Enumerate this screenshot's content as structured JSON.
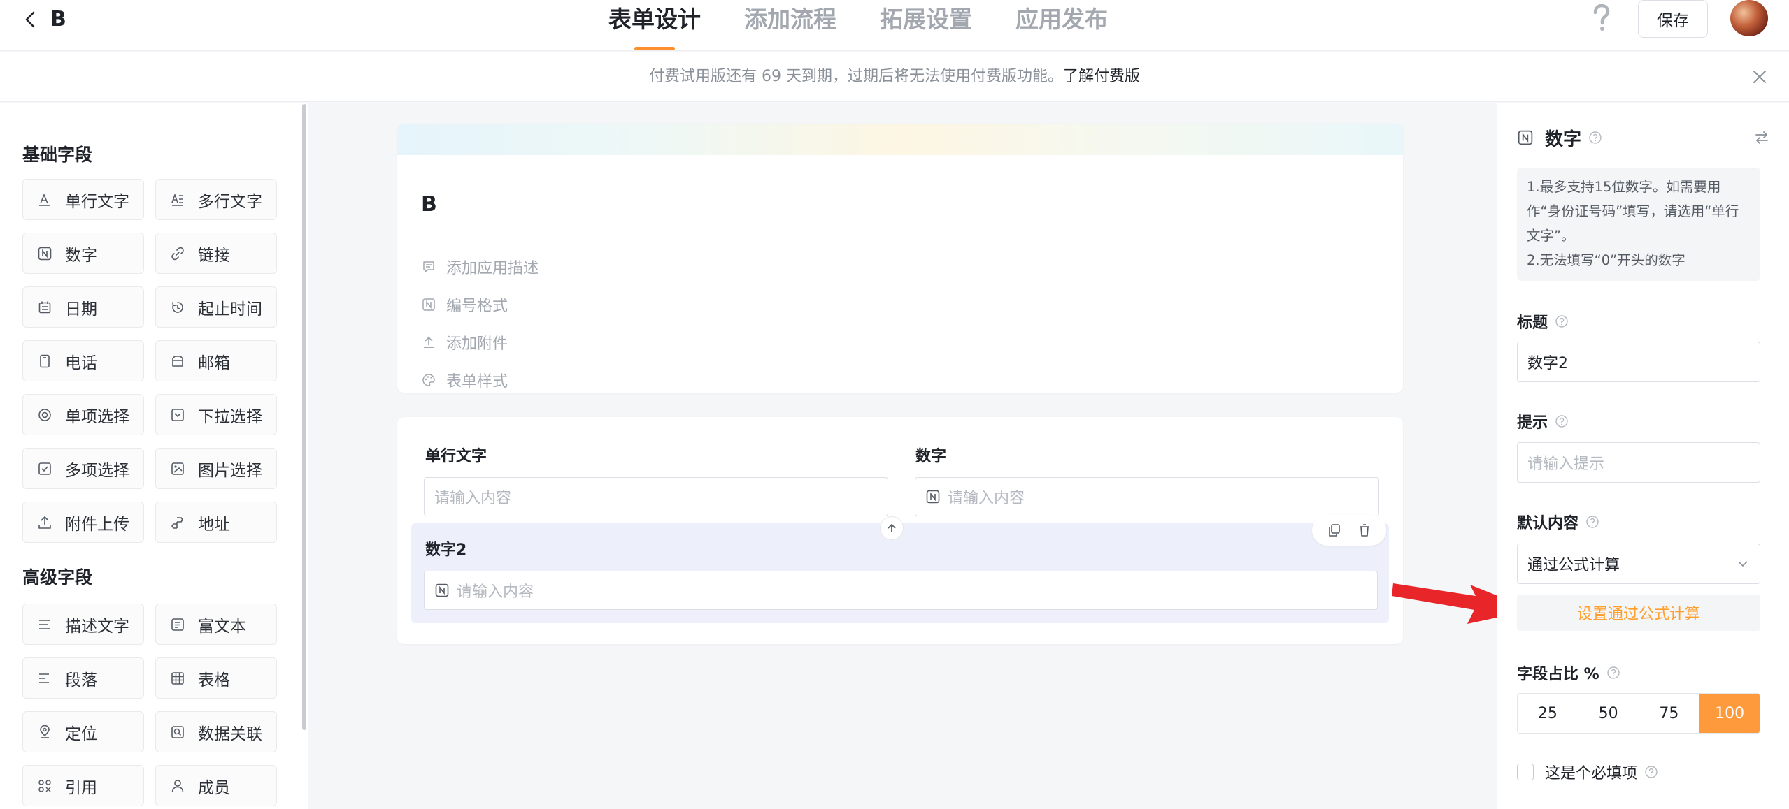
{
  "header": {
    "app_title": "B",
    "tabs": [
      {
        "label": "表单设计",
        "active": true
      },
      {
        "label": "添加流程",
        "active": false
      },
      {
        "label": "拓展设置",
        "active": false
      },
      {
        "label": "应用发布",
        "active": false
      }
    ],
    "save_label": "保存"
  },
  "banner": {
    "text": "付费试用版还有 69 天到期，过期后将无法使用付费版功能。",
    "link": "了解付费版"
  },
  "sidebar": {
    "basic_title": "基础字段",
    "basic_fields": [
      {
        "label": "单行文字",
        "icon": "text-icon"
      },
      {
        "label": "多行文字",
        "icon": "multiline-text-icon"
      },
      {
        "label": "数字",
        "icon": "number-icon"
      },
      {
        "label": "链接",
        "icon": "link-icon"
      },
      {
        "label": "日期",
        "icon": "calendar-icon"
      },
      {
        "label": "起止时间",
        "icon": "time-range-icon"
      },
      {
        "label": "电话",
        "icon": "phone-icon"
      },
      {
        "label": "邮箱",
        "icon": "mail-icon"
      },
      {
        "label": "单项选择",
        "icon": "radio-icon"
      },
      {
        "label": "下拉选择",
        "icon": "dropdown-icon"
      },
      {
        "label": "多项选择",
        "icon": "checkbox-icon"
      },
      {
        "label": "图片选择",
        "icon": "image-icon"
      },
      {
        "label": "附件上传",
        "icon": "upload-icon"
      },
      {
        "label": "地址",
        "icon": "address-icon"
      }
    ],
    "advanced_title": "高级字段",
    "advanced_fields": [
      {
        "label": "描述文字",
        "icon": "description-icon"
      },
      {
        "label": "富文本",
        "icon": "rich-text-icon"
      },
      {
        "label": "段落",
        "icon": "paragraph-icon"
      },
      {
        "label": "表格",
        "icon": "table-icon"
      },
      {
        "label": "定位",
        "icon": "location-icon"
      },
      {
        "label": "数据关联",
        "icon": "data-link-icon"
      },
      {
        "label": "引用",
        "icon": "reference-icon"
      },
      {
        "label": "成员",
        "icon": "member-icon"
      }
    ]
  },
  "form": {
    "title": "B",
    "meta": [
      {
        "label": "添加应用描述",
        "icon": "description-icon"
      },
      {
        "label": "编号格式",
        "icon": "number-format-icon"
      },
      {
        "label": "添加附件",
        "icon": "attachment-icon"
      },
      {
        "label": "表单样式",
        "icon": "palette-icon"
      }
    ],
    "fields": [
      {
        "label": "单行文字",
        "placeholder": "请输入内容"
      },
      {
        "label": "数字",
        "placeholder": "请输入内容"
      },
      {
        "label": "数字2",
        "placeholder": "请输入内容"
      }
    ]
  },
  "properties": {
    "field_type": "数字",
    "tips": [
      "1.最多支持15位数字。如需要用作“身份证号码”填写，请选用“单行文字”。",
      "2.无法填写“0”开头的数字"
    ],
    "title_label": "标题",
    "title_value": "数字2",
    "hint_label": "提示",
    "hint_placeholder": "请输入提示",
    "default_label": "默认内容",
    "default_value": "通过公式计算",
    "formula_button": "设置通过公式计算",
    "ratio_label": "字段占比 %",
    "ratio_options": [
      "25",
      "50",
      "75",
      "100"
    ],
    "ratio_selected": "100",
    "required_label": "这是个必填项",
    "required_checked": false
  },
  "colors": {
    "accent": "#ff8f2d",
    "selected_bg": "#edf0fa",
    "annotation_arrow": "#e8262a"
  }
}
